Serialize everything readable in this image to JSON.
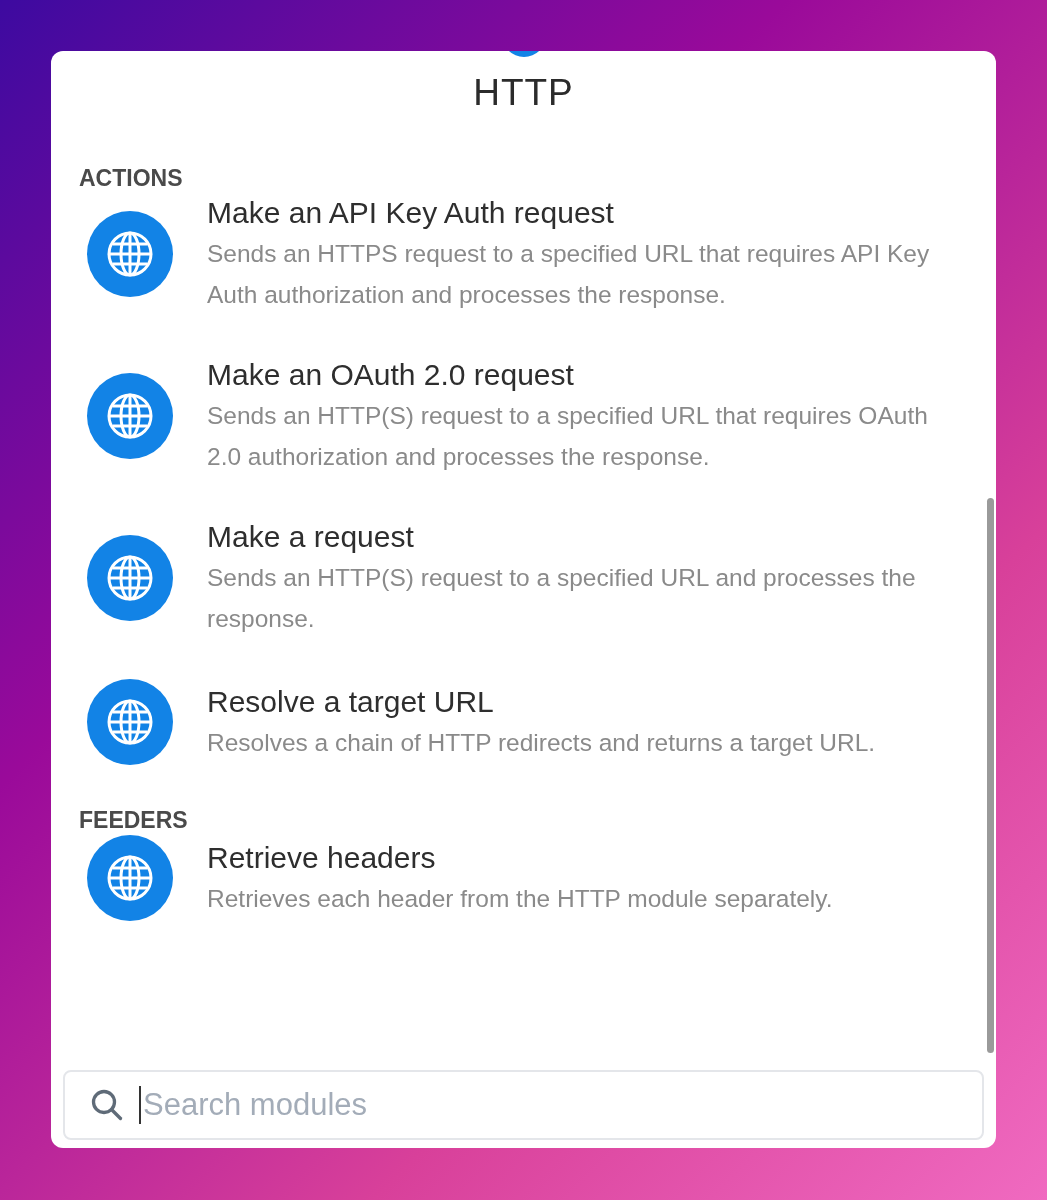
{
  "header": {
    "title": "HTTP"
  },
  "sections": [
    {
      "heading": "ACTIONS",
      "items": [
        {
          "title": "Make an API Key Auth request",
          "description": "Sends an HTTPS request to a specified URL that requires API Key Auth authorization and processes the response."
        },
        {
          "title": "Make an OAuth 2.0 request",
          "description": "Sends an HTTP(S) request to a specified URL that requires OAuth 2.0 authorization and processes the response."
        },
        {
          "title": "Make a request",
          "description": "Sends an HTTP(S) request to a specified URL and processes the response."
        },
        {
          "title": "Resolve a target URL",
          "description": "Resolves a chain of HTTP redirects and returns a target URL."
        }
      ]
    },
    {
      "heading": "FEEDERS",
      "items": [
        {
          "title": "Retrieve headers",
          "description": "Retrieves each header from the HTTP module separately."
        }
      ]
    }
  ],
  "search": {
    "placeholder": "Search modules"
  }
}
